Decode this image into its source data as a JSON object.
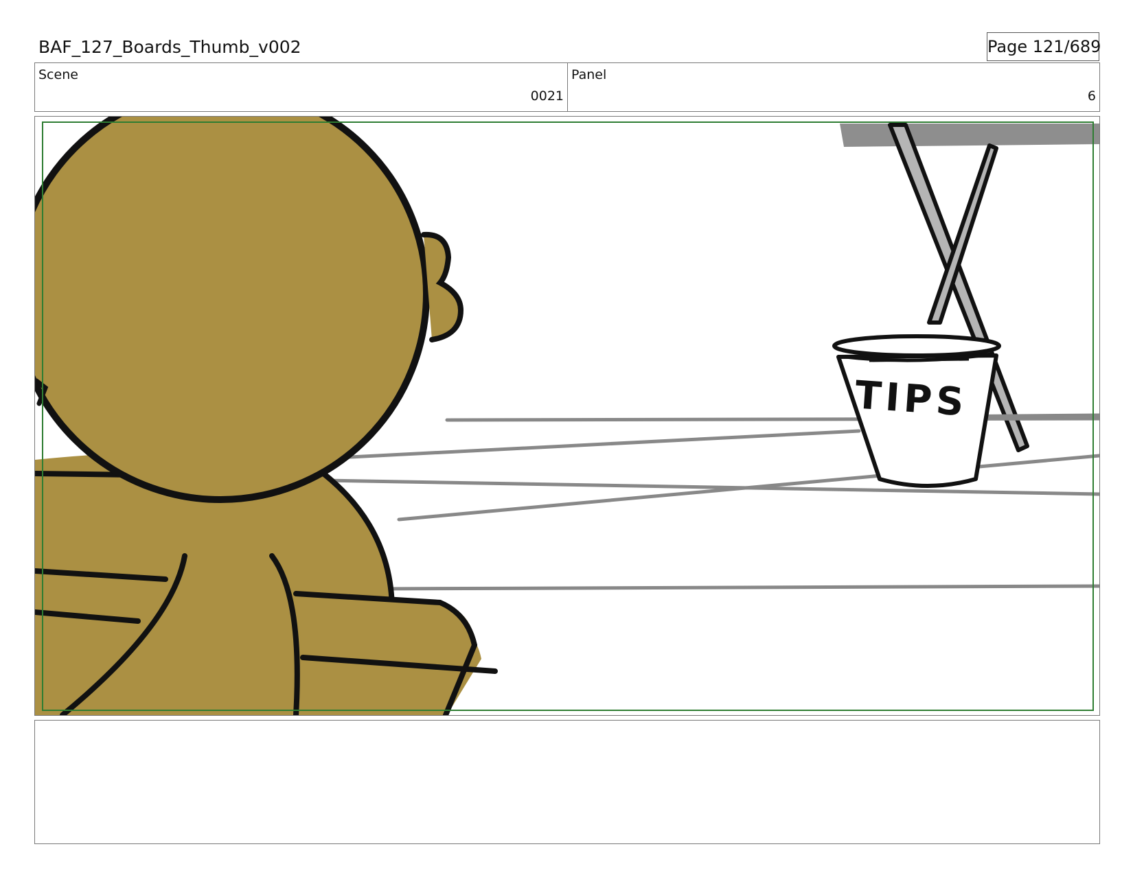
{
  "header": {
    "title": "BAF_127_Boards_Thumb_v002",
    "page": "Page 121/689"
  },
  "info": {
    "scene_label": "Scene",
    "scene_value": "0021",
    "panel_label": "Panel",
    "panel_value": "6"
  },
  "artwork": {
    "bucket_text": "TIPS",
    "character_color": "#ab9043",
    "safe_frame_color": "#2e7d32",
    "line_color": "#111111",
    "floor_line_color": "#888888"
  },
  "notes": {
    "text": ""
  }
}
